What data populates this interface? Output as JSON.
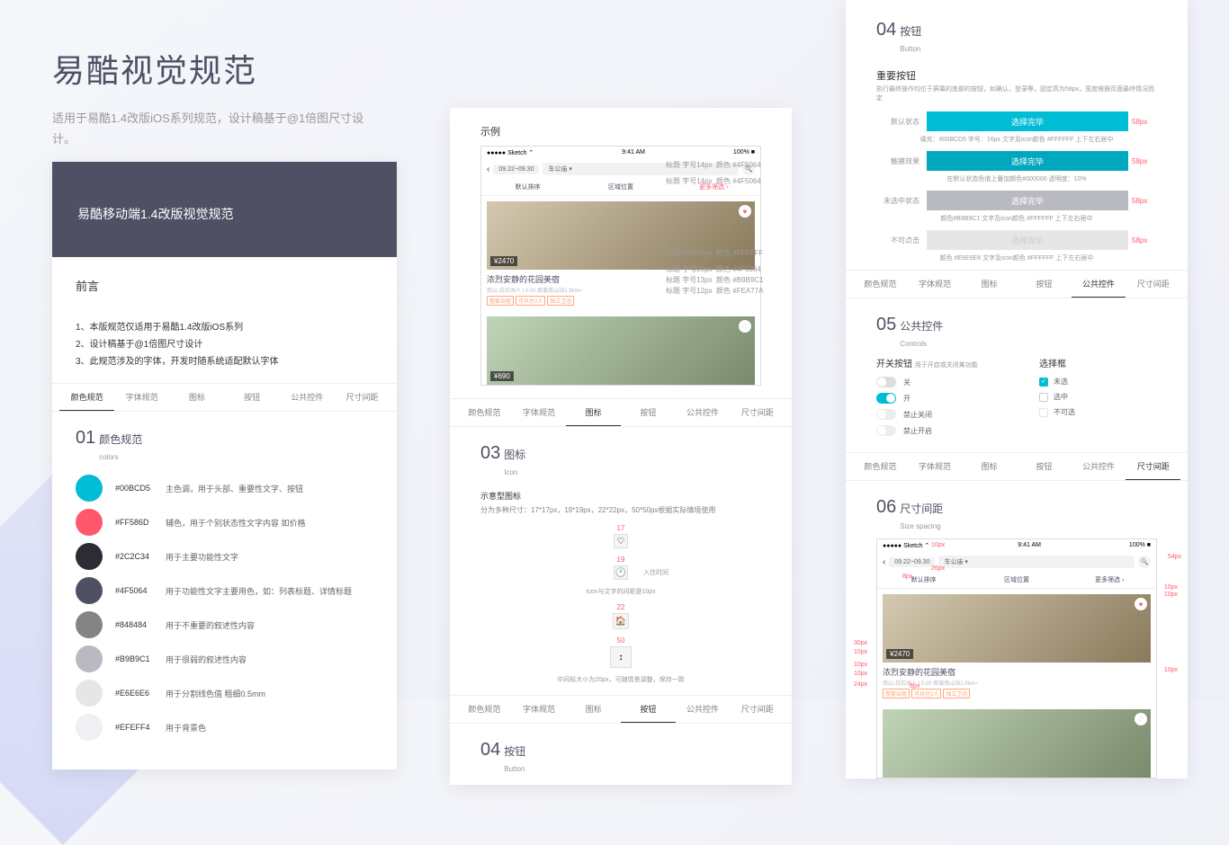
{
  "header": {
    "title": "易酷视觉规范",
    "subtitle": "适用于易酷1.4改版iOS系列规范，设计稿基于@1倍图尺寸设计。"
  },
  "card1": {
    "header": "易酷移动端1.4改版视觉规范",
    "preface": "前言",
    "rules": [
      "1、本版规范仅适用于易酷1.4改版iOS系列",
      "2、设计稿基于@1倍图尺寸设计",
      "3、此规范涉及的字体，开发时随系统适配默认字体"
    ],
    "tabs": [
      "颜色规范",
      "字体规范",
      "图标",
      "按钮",
      "公共控件",
      "尺寸间距"
    ]
  },
  "section1": {
    "num": "01",
    "name": "颜色规范",
    "sub": "colors"
  },
  "colors": [
    {
      "hex": "#00BCD5",
      "desc": "主色调，用于头部、重要性文字、按钮"
    },
    {
      "hex": "#FF586D",
      "desc": "辅色，用于个别状态性文字内容 如价格"
    },
    {
      "hex": "#2C2C34",
      "desc": "用于主要功能性文字"
    },
    {
      "hex": "#4F5064",
      "desc": "用于功能性文字主要用色，如：列表标题、详情标题"
    },
    {
      "hex": "#848484",
      "desc": "用于不重要的叙述性内容"
    },
    {
      "hex": "#B9B9C1",
      "desc": "用于很弱的叙述性内容"
    },
    {
      "hex": "#E6E6E6",
      "desc": "用于分割线色值 粗细0.5mm"
    },
    {
      "hex": "#EFEFF4",
      "desc": "用于背景色"
    }
  ],
  "card2": {
    "example": "示例",
    "status": {
      "carrier": "●●●●● Sketch ⌃",
      "time": "9:41 AM",
      "bat": "100% ■"
    },
    "search": {
      "back": "‹",
      "date": "09.22~09.30",
      "type": "车公庙 ▾"
    },
    "filters": [
      "默认排序",
      "区域位置",
      "更多筛选 ›"
    ],
    "listing": {
      "price": "¥2470",
      "title": "浓烈安静的花园美宿",
      "meta": "南山·白石洲人 | 0.00  距离南山站1.9km≈",
      "tags": [
        "整套出租",
        "可共住2人",
        "独立卫浴"
      ]
    },
    "listing2": {
      "price": "¥690"
    },
    "annos": [
      {
        "t": "标题 字号14px",
        "c": "颜色 #4F5064"
      },
      {
        "t": "标题 字号14px",
        "c": "颜色 #4F5064"
      },
      {
        "t": "标题 字号24px",
        "c": "颜色 #FFFFFF"
      },
      {
        "t": "标题 字号20px",
        "c": "颜色 #4F5064"
      },
      {
        "t": "标题 字号13px",
        "c": "颜色 #B9B9C1"
      },
      {
        "t": "标题 字号12px",
        "c": "颜色 #FEA77A"
      }
    ]
  },
  "section3": {
    "num": "03",
    "name": "图标",
    "sub": "Icon",
    "title2": "示意型图标",
    "desc": "分为多种尺寸：17*17px，19*19px，22*22px，50*50px根据实际情境使用",
    "sizes": [
      "17",
      "19",
      "22",
      "50"
    ],
    "note1": "入住时间",
    "note2": "Icon与文字的间距是10px",
    "note3": "中间标大小为20px，可随情景调整，保持一致"
  },
  "section4": {
    "num": "04",
    "name": "按钮",
    "sub": "Button",
    "sub2": "重要按钮",
    "desc": "执行最终操作均位于屏幕的底部的按钮，如确认，登录等，固定高为58px，宽度根据页面最终情况而定",
    "rows": [
      {
        "lbl": "默认状态",
        "bg": "#00BCD5",
        "txt": "选择完毕",
        "px": "58px",
        "note": "填充：#00BCD5  字号：16px 文字及icon颜色 #FFFFFF 上下左右居中"
      },
      {
        "lbl": "触摸效果",
        "bg": "#00A8BF",
        "txt": "选择完毕",
        "px": "58px",
        "note": "在默认状态色值上叠加颜色#000000 透明度：10%"
      },
      {
        "lbl": "未选中状态",
        "bg": "#B9B9C1",
        "txt": "选择完毕",
        "px": "58px",
        "note": "颜色#B9B9C1 文字及icon颜色 #FFFFFF 上下左右居中"
      },
      {
        "lbl": "不可点击",
        "bg": "#E6E6E6",
        "txt": "选择完毕",
        "px": "58px",
        "note": "颜色 #E6E6E6  文字及icon颜色 #FFFFFF 上下左右居中",
        "tc": "#ccc"
      }
    ]
  },
  "section5": {
    "num": "05",
    "name": "公共控件",
    "sub": "Controls",
    "switch_title": "开关按钮",
    "switch_sub": "用于开启或关闭某功能",
    "switches": [
      {
        "on": false,
        "lbl": "关"
      },
      {
        "on": true,
        "lbl": "开"
      },
      {
        "on": false,
        "lbl": "禁止关闭",
        "dis": true
      },
      {
        "on": false,
        "lbl": "禁止开启",
        "dis": true
      }
    ],
    "cb_title": "选择框",
    "checks": [
      {
        "on": true,
        "lbl": "未选"
      },
      {
        "on": false,
        "lbl": "选中"
      },
      {
        "on": false,
        "lbl": "不可选",
        "dis": true
      }
    ]
  },
  "section6": {
    "num": "06",
    "name": "尺寸间距",
    "sub": "Size spacing",
    "annos": [
      "10px",
      "54px",
      "8px",
      "26px",
      "10px",
      "10px",
      "30px",
      "10px",
      "10px",
      "10px",
      "24px",
      "6px",
      "10px"
    ]
  }
}
